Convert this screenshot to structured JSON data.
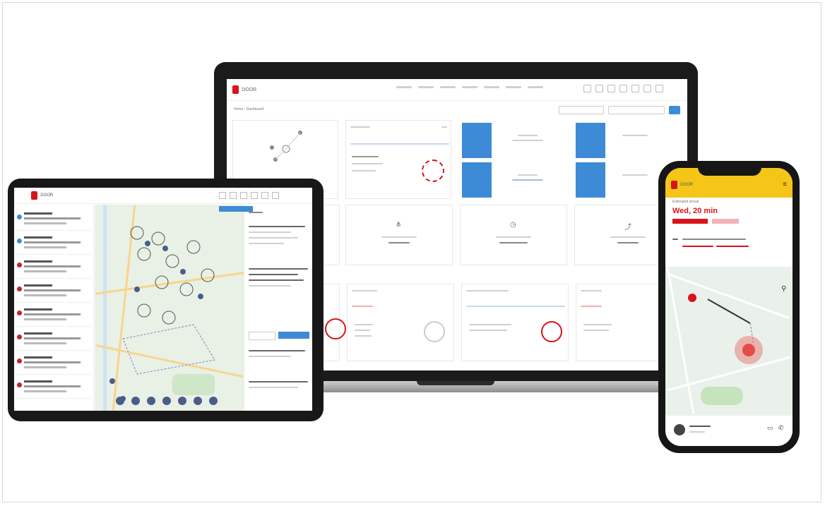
{
  "brand": {
    "name": "DOOR",
    "accent": "#d7141a",
    "phone_bar": "#f5c518",
    "tile_blue": "#3d8bd6"
  },
  "laptop": {
    "app_name": "DOOR",
    "breadcrumb": "Home  ›  Dashboard"
  },
  "tablet": {
    "app_name": "DOOR"
  },
  "phone": {
    "app_name": "DOOR",
    "eta_heading": "Estimated arrival",
    "eta_value": "Wed, 20 min"
  },
  "icons": [
    "logo-icon",
    "menu-icon",
    "phone-icon",
    "chat-icon",
    "map-pin-icon",
    "route-icon"
  ]
}
